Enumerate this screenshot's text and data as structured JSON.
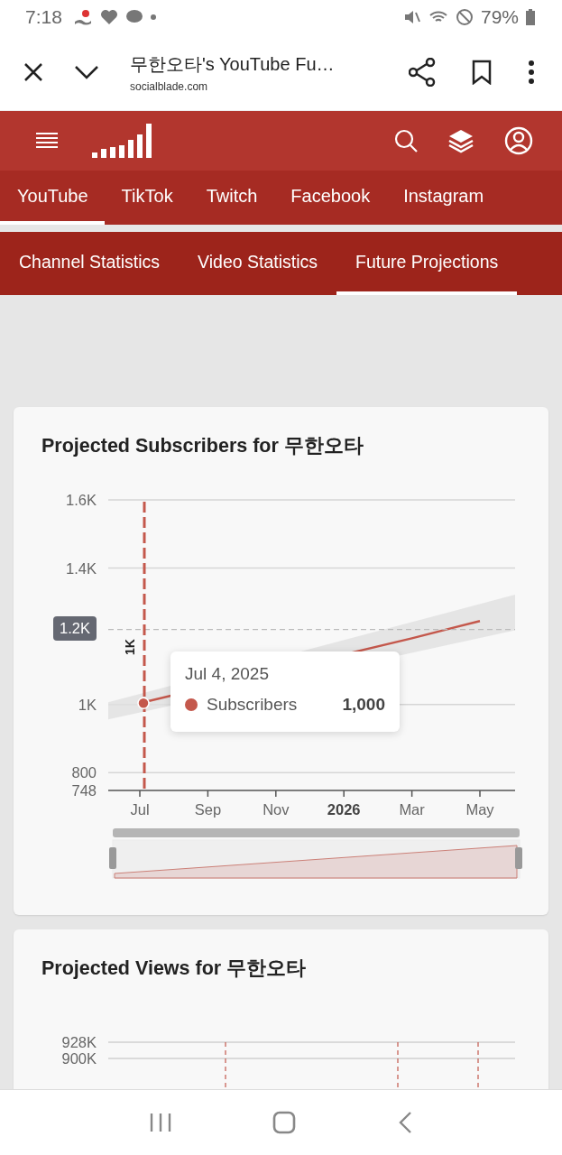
{
  "status_bar": {
    "time": "7:18",
    "battery": "79%"
  },
  "browser": {
    "title": "무한오타's YouTube Fu…",
    "url": "socialblade.com"
  },
  "platform_tabs": [
    {
      "label": "YouTube",
      "selected": true
    },
    {
      "label": "TikTok",
      "selected": false
    },
    {
      "label": "Twitch",
      "selected": false
    },
    {
      "label": "Facebook",
      "selected": false
    },
    {
      "label": "Instagram",
      "selected": false
    }
  ],
  "section_tabs": [
    {
      "label": "Channel Statistics",
      "selected": false
    },
    {
      "label": "Video Statistics",
      "selected": false
    },
    {
      "label": "Future Projections",
      "selected": true
    }
  ],
  "subscribers_card": {
    "title": "Projected Subscribers for 무한오타",
    "chart_data": {
      "type": "line",
      "x": [
        "Jul",
        "Sep",
        "Nov",
        "2026",
        "Mar",
        "May"
      ],
      "series": [
        {
          "name": "Subscribers",
          "color": "#c4584c",
          "values": [
            1004,
            null,
            null,
            null,
            1194,
            1245
          ]
        }
      ],
      "ref_lines": [
        {
          "axis": "y",
          "value": 1220,
          "label": "1.2K"
        },
        {
          "axis": "x",
          "value": "Jul",
          "label": "1K"
        }
      ],
      "grid": true,
      "ylim": [
        748,
        1600
      ],
      "yticks": [
        {
          "value": 748,
          "label": "748"
        },
        {
          "value": 800,
          "label": "800"
        },
        {
          "value": 1000,
          "label": "1K"
        },
        {
          "value": 1400,
          "label": "1.4K"
        },
        {
          "value": 1600,
          "label": "1.6K"
        }
      ]
    },
    "tooltip": {
      "date": "Jul 4, 2025",
      "value": "1,000"
    }
  },
  "views_card": {
    "title": "Projected Views for 무한오타",
    "y_labels": [
      "928K",
      "900K"
    ]
  }
}
